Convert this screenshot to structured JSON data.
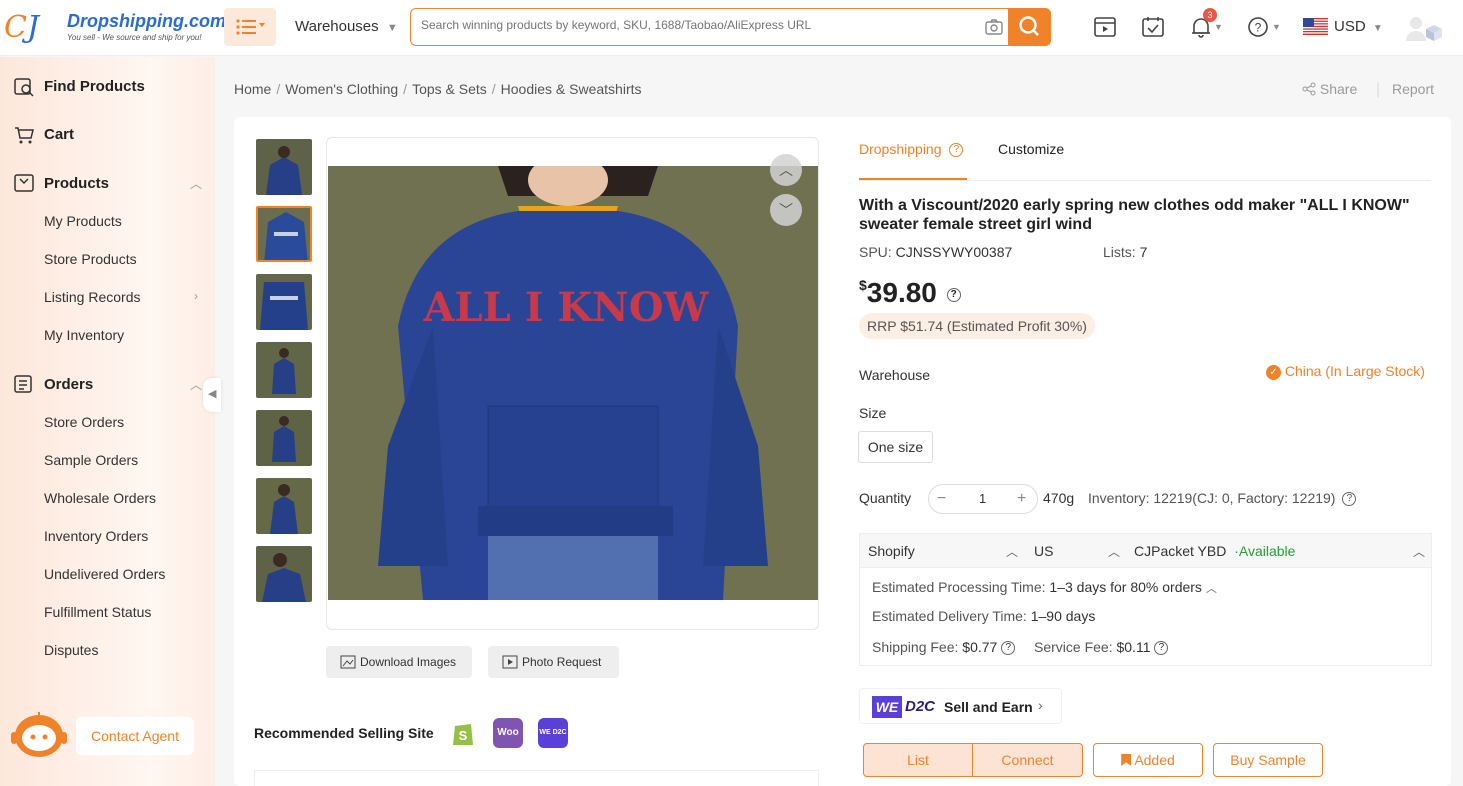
{
  "header": {
    "logo_name": "Dropshipping.com",
    "logo_tagline": "You sell - We source and ship for you!",
    "warehouses_label": "Warehouses",
    "search_placeholder": "Search winning products by keyword, SKU, 1688/Taobao/AliExpress URL",
    "notification_count": "3",
    "currency": "USD",
    "brand_color": "#f0832a"
  },
  "sidebar": {
    "find_products": "Find Products",
    "cart": "Cart",
    "products": "Products",
    "product_items": [
      "My Products",
      "Store Products",
      "Listing Records",
      "My Inventory"
    ],
    "orders": "Orders",
    "order_items": [
      "Store Orders",
      "Sample Orders",
      "Wholesale Orders",
      "Inventory Orders",
      "Undelivered Orders",
      "Fulfillment Status",
      "Disputes"
    ],
    "contact_agent": "Contact Agent"
  },
  "breadcrumb": [
    "Home",
    "Women's Clothing",
    "Tops & Sets",
    "Hoodies & Sweatshirts"
  ],
  "actions": {
    "share": "Share",
    "report": "Report"
  },
  "gallery": {
    "download_images": "Download Images",
    "photo_request": "Photo Request",
    "sweater_text": "ALL I KNOW",
    "recommended_label": "Recommended Selling Site"
  },
  "product": {
    "tab_dropshipping": "Dropshipping",
    "tab_customize": "Customize",
    "title": "With a Viscount/2020 early spring new clothes odd maker \"ALL I KNOW\" sweater female street girl wind",
    "spu_label": "SPU:",
    "spu": "CJNSSYWY00387",
    "lists_label": "Lists:",
    "lists": "7",
    "currency_symbol": "$",
    "price": "39.80",
    "rrp": "RRP $51.74 (Estimated Profit 30%)",
    "warehouse_label": "Warehouse",
    "warehouse_value": "China (In Large Stock)",
    "size_label": "Size",
    "size_option": "One size",
    "quantity_label": "Quantity",
    "quantity": "1",
    "weight": "470g",
    "inventory": "Inventory: 12219(CJ: 0, Factory: 12219)"
  },
  "shipping": {
    "platform": "Shopify",
    "country": "US",
    "method": "CJPacket YBD",
    "availability": "·Available",
    "processing_label": "Estimated Processing Time:",
    "processing_value": "1–3 days for 80% orders",
    "delivery_label": "Estimated Delivery Time:",
    "delivery_value": "1–90 days",
    "shipping_fee_label": "Shipping Fee:",
    "shipping_fee": "$0.77",
    "service_fee_label": "Service Fee:",
    "service_fee": "$0.11"
  },
  "wed2c": {
    "brand_we": "WE",
    "brand_d2c": "D2C",
    "label": "Sell and Earn"
  },
  "buttons": {
    "list": "List",
    "connect": "Connect",
    "added": "Added",
    "buy_sample": "Buy Sample"
  }
}
